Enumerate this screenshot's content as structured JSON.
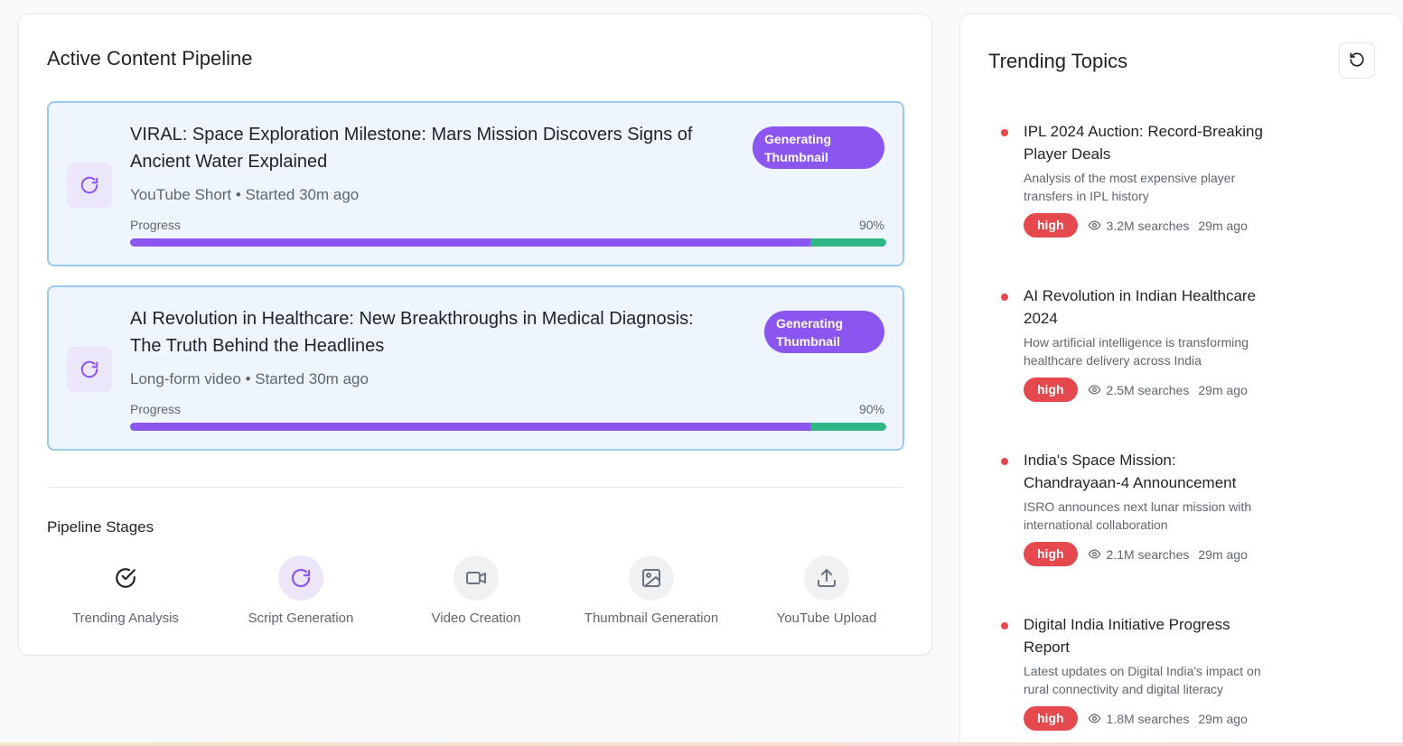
{
  "pipeline": {
    "title": "Active Content Pipeline",
    "jobs": [
      {
        "title": "VIRAL: Space Exploration Milestone: Mars Mission Discovers Signs of Ancient Water Explained",
        "meta": "YouTube Short • Started 30m ago",
        "status": "Generating\nThumbnail",
        "progress_label": "Progress",
        "progress_text": "90%",
        "progress_fraction": 0.9
      },
      {
        "title": "AI Revolution in Healthcare: New Breakthroughs in Medical Diagnosis: The Truth Behind the Headlines",
        "meta": "Long-form video • Started 30m ago",
        "status": "Generating\nThumbnail",
        "progress_label": "Progress",
        "progress_text": "90%",
        "progress_fraction": 0.9
      }
    ],
    "stages_title": "Pipeline Stages",
    "stages": [
      {
        "label": "Trending Analysis",
        "icon": "check-circle-icon",
        "state": "done"
      },
      {
        "label": "Script Generation",
        "icon": "loading-icon",
        "state": "active"
      },
      {
        "label": "Video Creation",
        "icon": "video-icon",
        "state": "pending"
      },
      {
        "label": "Thumbnail Generation",
        "icon": "image-icon",
        "state": "pending"
      },
      {
        "label": "YouTube Upload",
        "icon": "upload-icon",
        "state": "pending"
      }
    ]
  },
  "trending": {
    "title": "Trending Topics",
    "refresh_icon": "refresh-icon",
    "topics": [
      {
        "title": "IPL 2024 Auction: Record-Breaking Player Deals",
        "description": "Analysis of the most expensive player transfers in IPL history",
        "priority": "high",
        "searches": "3.2M searches",
        "time": "29m ago"
      },
      {
        "title": "AI Revolution in Indian Healthcare 2024",
        "description": "How artificial intelligence is transforming healthcare delivery across India",
        "priority": "high",
        "searches": "2.5M searches",
        "time": "29m ago"
      },
      {
        "title": "India's Space Mission: Chandrayaan-4 Announcement",
        "description": "ISRO announces next lunar mission with international collaboration",
        "priority": "high",
        "searches": "2.1M searches",
        "time": "29m ago"
      },
      {
        "title": "Digital India Initiative Progress Report",
        "description": "Latest updates on Digital India's impact on rural connectivity and digital literacy",
        "priority": "high",
        "searches": "1.8M searches",
        "time": "29m ago"
      }
    ]
  },
  "colors": {
    "accent_purple": "#8b55f0",
    "progress_green": "#2fb886",
    "priority_red": "#e5484d",
    "job_bg": "#eef5ff",
    "job_border": "#9cc8ee"
  }
}
